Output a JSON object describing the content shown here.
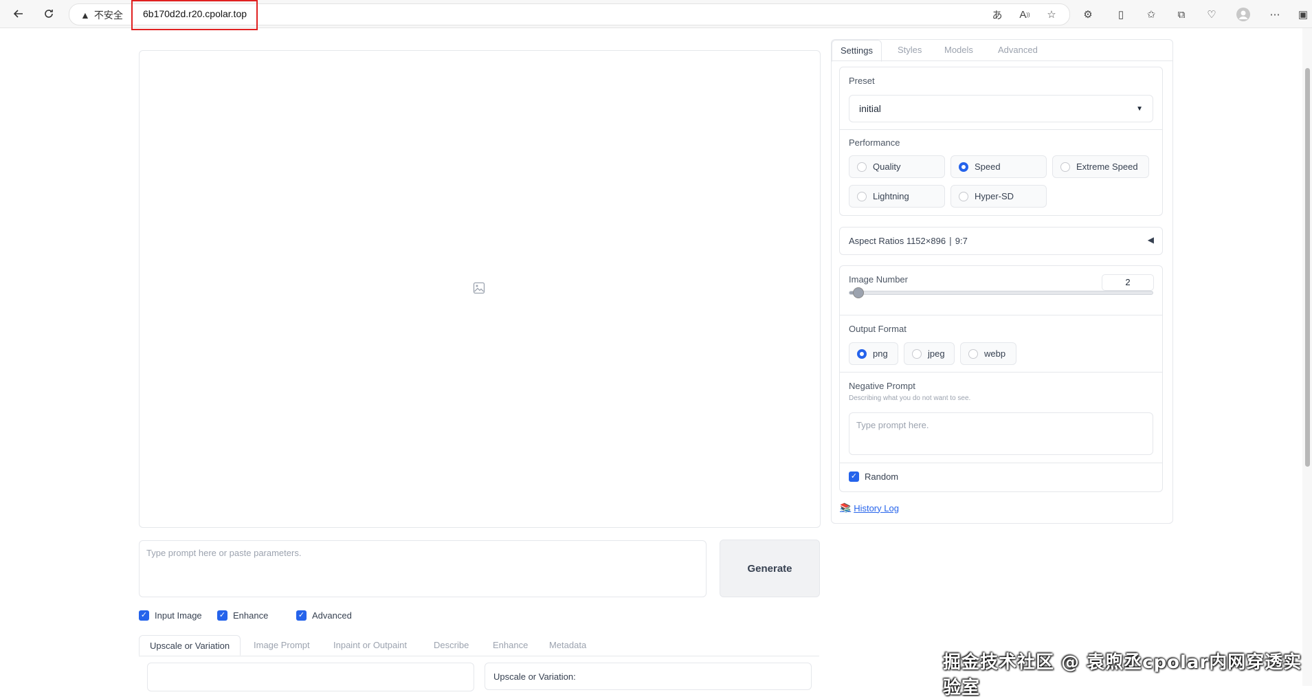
{
  "browser": {
    "insecure_label": "不安全",
    "url": "6b170d2d.r20.cpolar.top"
  },
  "main": {
    "prompt_placeholder": "Type prompt here or paste parameters.",
    "generate_label": "Generate",
    "checkboxes": [
      {
        "label": "Input Image",
        "checked": true
      },
      {
        "label": "Enhance",
        "checked": true
      },
      {
        "label": "Advanced",
        "checked": true
      }
    ],
    "tabs": [
      "Upscale or Variation",
      "Image Prompt",
      "Inpaint or Outpaint",
      "Describe",
      "Enhance",
      "Metadata"
    ],
    "upscale_label": "Upscale or Variation:"
  },
  "settings": {
    "tabs": [
      "Settings",
      "Styles",
      "Models",
      "Advanced"
    ],
    "preset": {
      "label": "Preset",
      "value": "initial"
    },
    "performance": {
      "label": "Performance",
      "options": [
        "Quality",
        "Speed",
        "Extreme Speed",
        "Lightning",
        "Hyper-SD"
      ],
      "selected": "Speed"
    },
    "aspect_ratios": "Aspect Ratios 1152×896 ∣ 9:7",
    "image_number": {
      "label": "Image Number",
      "value": "2",
      "fraction": 0.03
    },
    "output_format": {
      "label": "Output Format",
      "options": [
        "png",
        "jpeg",
        "webp"
      ],
      "selected": "png"
    },
    "negative_prompt": {
      "label": "Negative Prompt",
      "hint": "Describing what you do not want to see.",
      "placeholder": "Type prompt here."
    },
    "random_label": "Random",
    "history_log": "History Log"
  },
  "watermark": "掘金技术社区 @ 袁煦丞cpolar内网穿透实验室",
  "colors": {
    "accent": "#2563eb",
    "highlight_box": "#e02020"
  }
}
